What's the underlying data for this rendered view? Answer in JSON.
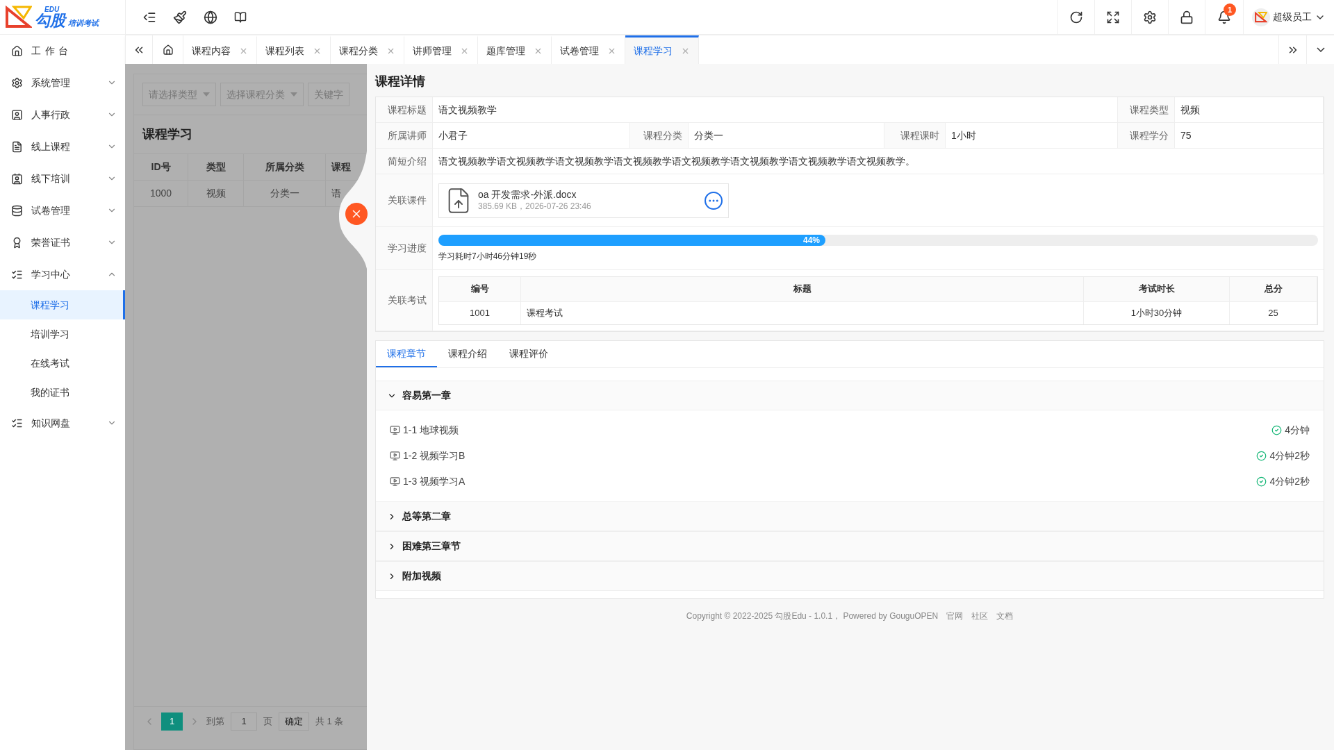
{
  "header": {
    "logo_super": "EDU",
    "logo_main": "勾股",
    "logo_sub": "培训考试",
    "notification_count": "1",
    "user_name": "超级员工"
  },
  "sidebar": {
    "items": [
      {
        "label": "工作台",
        "kind": "link"
      },
      {
        "label": "系统管理",
        "kind": "group",
        "expanded": false
      },
      {
        "label": "人事行政",
        "kind": "group",
        "expanded": false
      },
      {
        "label": "线上课程",
        "kind": "group",
        "expanded": false
      },
      {
        "label": "线下培训",
        "kind": "group",
        "expanded": false
      },
      {
        "label": "试卷管理",
        "kind": "group",
        "expanded": false
      },
      {
        "label": "荣誉证书",
        "kind": "group",
        "expanded": false
      },
      {
        "label": "学习中心",
        "kind": "group",
        "expanded": true,
        "children": [
          {
            "label": "课程学习",
            "selected": true
          },
          {
            "label": "培训学习",
            "selected": false
          },
          {
            "label": "在线考试",
            "selected": false
          },
          {
            "label": "我的证书",
            "selected": false
          }
        ]
      },
      {
        "label": "知识网盘",
        "kind": "group",
        "expanded": false
      }
    ]
  },
  "tabs": [
    {
      "label": "课程内容",
      "selected": false
    },
    {
      "label": "课程列表",
      "selected": false
    },
    {
      "label": "课程分类",
      "selected": false
    },
    {
      "label": "讲师管理",
      "selected": false
    },
    {
      "label": "题库管理",
      "selected": false
    },
    {
      "label": "试卷管理",
      "selected": false
    },
    {
      "label": "课程学习",
      "selected": true
    }
  ],
  "list_page": {
    "filters": [
      {
        "placeholder": "请选择类型"
      },
      {
        "placeholder": "选择课程分类"
      },
      {
        "placeholder": "关键字"
      }
    ],
    "title": "课程学习",
    "columns": [
      "ID号",
      "类型",
      "所属分类",
      "课程"
    ],
    "rows": [
      [
        "1000",
        "视频",
        "分类一",
        "语"
      ]
    ],
    "pagination": {
      "pages": [
        {
          "label": "1",
          "selected": true
        }
      ],
      "goto_label": "到第",
      "goto_value": "1",
      "page_unit": "页",
      "confirm": "确定",
      "total": "共 1 条"
    }
  },
  "drawer": {
    "title": "课程详情",
    "fields": {
      "title_label": "课程标题",
      "title": "语文视频教学",
      "type_label": "课程类型",
      "type": "视频",
      "teacher_label": "所属讲师",
      "teacher": "小君子",
      "category_label": "课程分类",
      "category": "分类一",
      "hours_label": "课程课时",
      "hours": "1小时",
      "credit_label": "课程学分",
      "credit": "75",
      "intro_label": "简短介绍",
      "intro": "语文视频教学语文视频教学语文视频教学语文视频教学语文视频教学语文视频教学语文视频教学语文视频教学。"
    },
    "attachment": {
      "label": "关联课件",
      "name": "oa 开发需求-外派.docx",
      "meta": "385.69 KB，2026-07-26 23:46"
    },
    "progress": {
      "label": "学习进度",
      "level": 0.44,
      "reading": "44%",
      "time_spent": "学习耗时7小时46分钟19秒"
    },
    "exams": {
      "label": "关联考试",
      "columns": [
        "编号",
        "标题",
        "考试时长",
        "总分"
      ],
      "rows": [
        [
          "1001",
          "课程考试",
          "1小时30分钟",
          "25"
        ]
      ]
    },
    "tabs": [
      {
        "label": "课程章节",
        "selected": true
      },
      {
        "label": "课程介绍",
        "selected": false
      },
      {
        "label": "课程评价",
        "selected": false
      }
    ],
    "chapters": [
      {
        "title": "容易第一章",
        "expanded": true,
        "lessons": [
          {
            "title": "1-1 地球视频",
            "duration": "4分钟",
            "done": true
          },
          {
            "title": "1-2 视频学习B",
            "duration": "4分钟2秒",
            "done": true
          },
          {
            "title": "1-3 视频学习A",
            "duration": "4分钟2秒",
            "done": true
          }
        ]
      },
      {
        "title": "总等第二章",
        "expanded": false
      },
      {
        "title": "困难第三章节",
        "expanded": false
      },
      {
        "title": "附加视频",
        "expanded": false
      }
    ]
  },
  "footer": {
    "copyright": "Copyright © 2022-2025 勾股Edu - 1.0.1， Powered by GouguOPEN",
    "links": [
      "官网",
      "社区",
      "文档"
    ]
  }
}
